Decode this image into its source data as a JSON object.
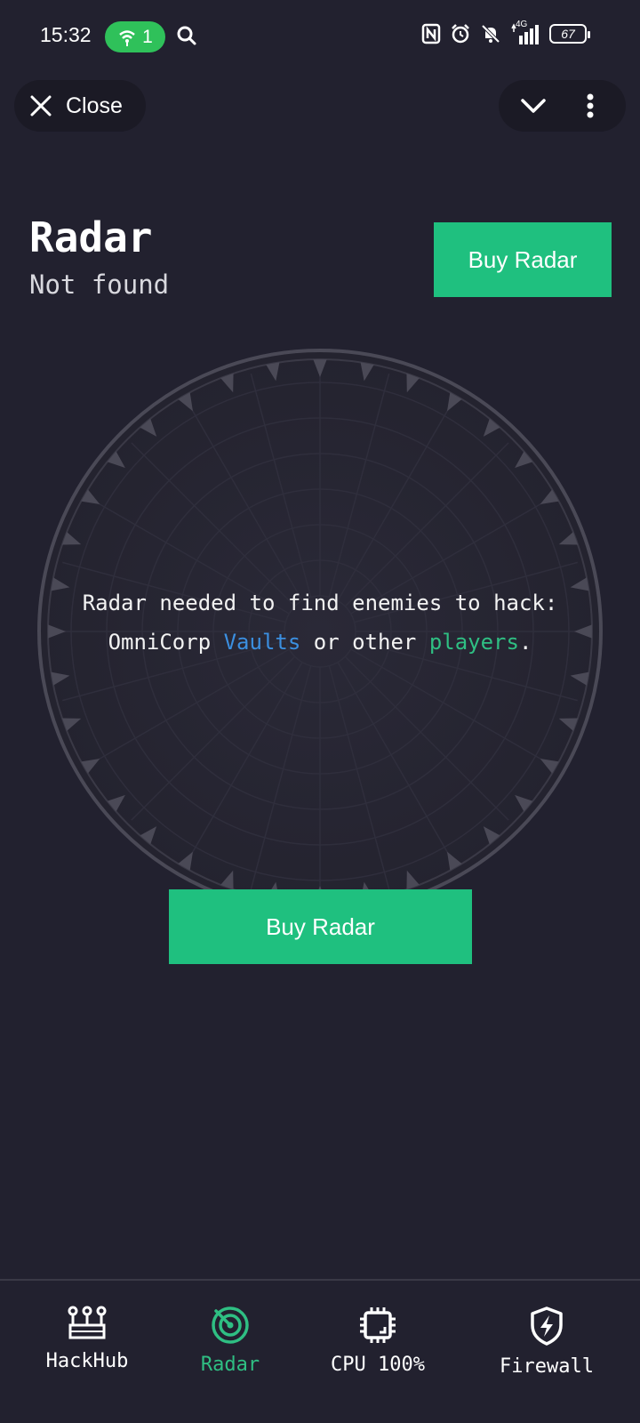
{
  "status_bar": {
    "time": "15:32",
    "hotspot_count": "1",
    "network": "4G",
    "battery": "67"
  },
  "app_bar": {
    "close_label": "Close"
  },
  "header": {
    "title": "Radar",
    "subtitle": "Not found",
    "buy_label": "Buy Radar"
  },
  "radar": {
    "message_part1": "Radar needed to find enemies to hack: OmniCorp ",
    "vaults_link": "Vaults",
    "message_part2": " or other ",
    "players_link": "players",
    "message_end": ".",
    "buy_label": "Buy Radar"
  },
  "bottom_nav": {
    "items": [
      {
        "label": "HackHub",
        "icon": "hackhub-icon"
      },
      {
        "label": "Radar",
        "icon": "radar-icon"
      },
      {
        "label": "CPU 100%",
        "icon": "cpu-icon"
      },
      {
        "label": "Firewall",
        "icon": "firewall-icon"
      }
    ],
    "active_color": "#2fbf83"
  },
  "colors": {
    "background": "#22212f",
    "accent": "#1fc07f",
    "link_blue": "#3b8fe0"
  }
}
